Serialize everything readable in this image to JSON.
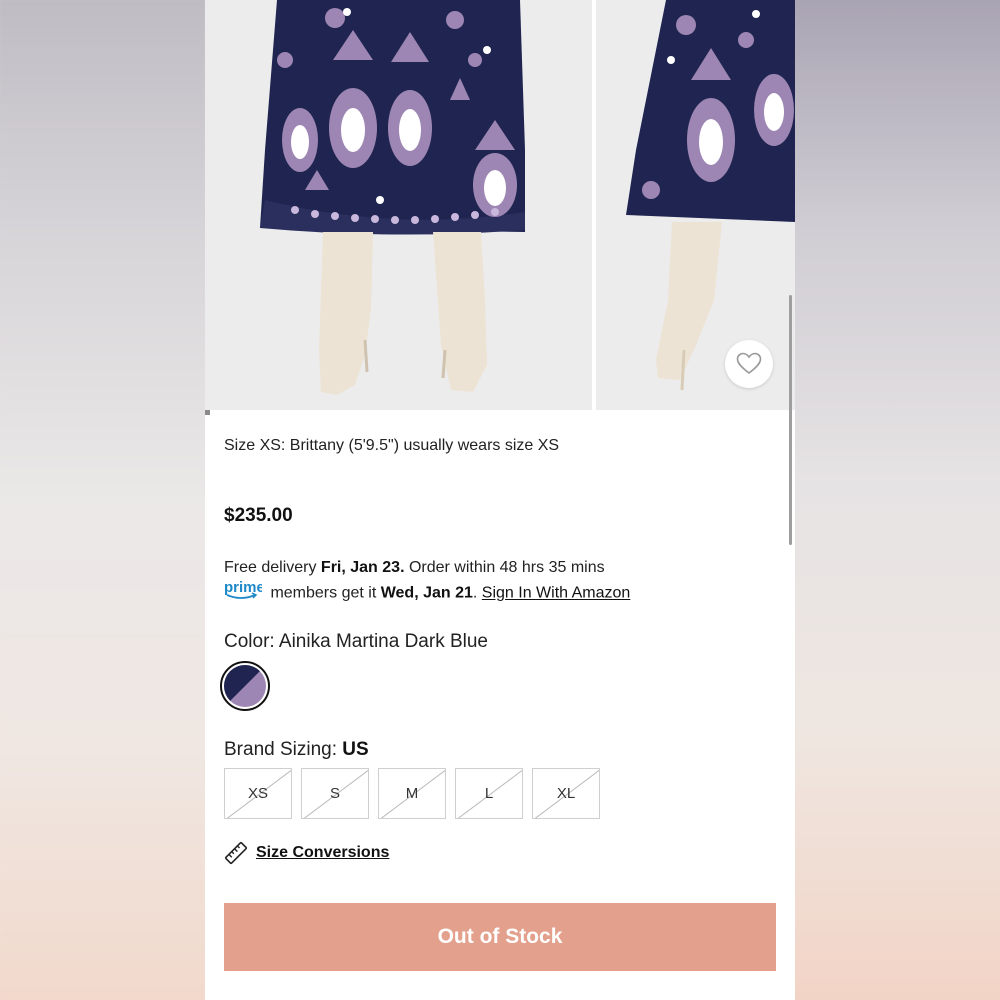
{
  "product": {
    "fit_note": "Size XS: Brittany (5'9.5\") usually wears size XS",
    "price": "$235.00"
  },
  "delivery": {
    "line1_prefix": "Free delivery ",
    "line1_date": "Fri, Jan 23.",
    "line1_suffix": " Order within 48 hrs 35 mins",
    "prime_logo": "prime",
    "line2_prefix": " members get it ",
    "line2_date": "Wed, Jan 21",
    "line2_sep": ". ",
    "sign_in_link": "Sign In With Amazon"
  },
  "color": {
    "label": "Color: Ainika Martina Dark Blue",
    "swatch_colors": [
      "#1f2550",
      "#9d86b3"
    ]
  },
  "sizing": {
    "label_prefix": "Brand Sizing: ",
    "label_value": "US",
    "sizes": [
      "XS",
      "S",
      "M",
      "L",
      "XL"
    ],
    "all_unavailable": true
  },
  "size_conversions": {
    "label": "Size Conversions",
    "icon": "ruler-icon"
  },
  "cta": {
    "label": "Out of Stock",
    "color": "#e3a08c"
  },
  "icons": {
    "wishlist": "heart-outline-icon"
  },
  "colors": {
    "skirt_navy": "#1f2550",
    "skirt_lavender": "#9d86b3",
    "boot_cream": "#ede3d4"
  }
}
